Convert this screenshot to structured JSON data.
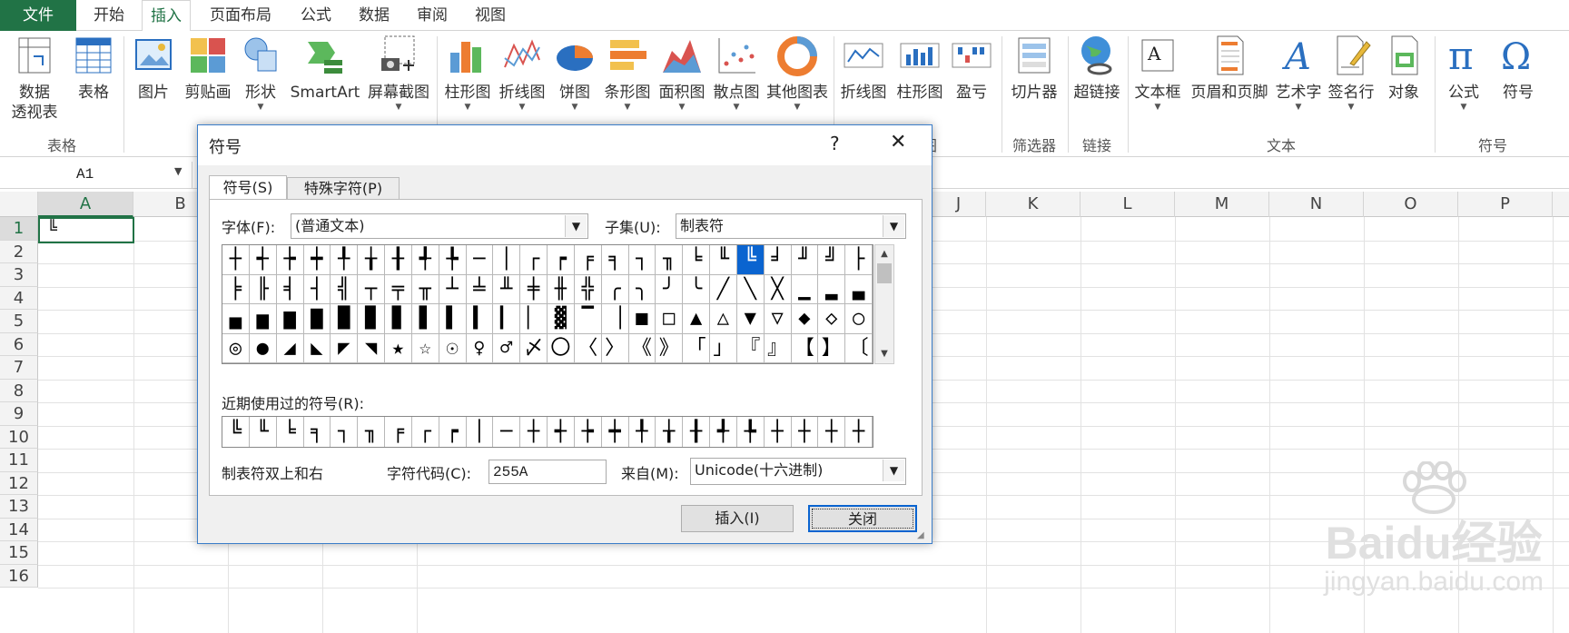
{
  "tabs": {
    "file": "文件",
    "home": "开始",
    "insert": "插入",
    "layout": "页面布局",
    "formulas": "公式",
    "data": "数据",
    "review": "审阅",
    "view": "视图"
  },
  "ribbon": {
    "pivot_l1": "数据",
    "pivot_l2": "透视表",
    "table": "表格",
    "picture": "图片",
    "clipart": "剪贴画",
    "shapes": "形状",
    "smartart": "SmartArt",
    "screenshot": "屏幕截图",
    "bar": "柱形图",
    "line": "折线图",
    "pie": "饼图",
    "hbar": "条形图",
    "area": "面积图",
    "scatter": "散点图",
    "other": "其他图表",
    "sp_line": "折线图",
    "sp_bar": "柱形图",
    "sp_wl": "盈亏",
    "slicer": "切片器",
    "hyperlink": "超链接",
    "textbox": "文本框",
    "headerfooter": "页眉和页脚",
    "wordart": "艺术字",
    "signature": "签名行",
    "object": "对象",
    "equation": "公式",
    "symbol": "符号",
    "groups": {
      "tables": "表格",
      "chart_partial": "图",
      "filter": "筛选器",
      "links": "链接",
      "text": "文本",
      "symbols": "符号"
    }
  },
  "formula_bar": {
    "name_box": "A1"
  },
  "columns": [
    "A",
    "B",
    "J",
    "K",
    "L",
    "M",
    "N",
    "O",
    "P"
  ],
  "rows": [
    "1",
    "2",
    "3",
    "4",
    "5",
    "6",
    "7",
    "8",
    "9",
    "10",
    "11",
    "12",
    "13",
    "14",
    "15",
    "16"
  ],
  "cell_a1": "╚",
  "dialog": {
    "title": "符号",
    "help": "?",
    "close_x": "✕",
    "tab_symbols": "符号(S)",
    "tab_special": "特殊字符(P)",
    "font_label": "字体(F):",
    "font_value": "(普通文本)",
    "subset_label": "子集(U):",
    "subset_value": "制表符",
    "symbols": [
      "┼",
      "┽",
      "┾",
      "┿",
      "╀",
      "╁",
      "╂",
      "╃",
      "╄",
      "─",
      "│",
      "┌",
      "┍",
      "╒",
      "╕",
      "┐",
      "╖",
      "╘",
      "╙",
      "╚",
      "╛",
      "╜",
      "╝",
      "├",
      "╞",
      "╟",
      "╡",
      "┤",
      "╣",
      "┬",
      "╤",
      "╥",
      "┴",
      "╧",
      "╨",
      "╪",
      "╫",
      "╬",
      "╭",
      "╮",
      "╯",
      "╰",
      "╱",
      "╲",
      "╳",
      "▁",
      "▂",
      "▃",
      "▄",
      "▅",
      "▆",
      "▇",
      "█",
      "▉",
      "▊",
      "▋",
      "▌",
      "▍",
      "▎",
      "▏",
      "▓",
      "▔",
      "▕",
      "■",
      "□",
      "▲",
      "△",
      "▼",
      "▽",
      "◆",
      "◇",
      "○",
      "◎",
      "●",
      "◢",
      "◣",
      "◤",
      "◥",
      "★",
      "☆",
      "☉",
      "♀",
      "♂",
      "〆",
      "〇",
      "〈",
      "〉",
      "《",
      "》",
      "「",
      "」",
      "『",
      "』",
      "【",
      "】",
      "〔"
    ],
    "selected_index": 19,
    "scroll_up": "▲",
    "scroll_down": "▼",
    "recent_label": "近期使用过的符号(R):",
    "recent": [
      "╚",
      "╙",
      "╘",
      "╕",
      "┐",
      "╖",
      "╒",
      "┌",
      "┍",
      "│",
      "─",
      "┼",
      "┽",
      "┾",
      "┿",
      "╀",
      "╁",
      "╂",
      "╃",
      "╄",
      "┼",
      "┼",
      "┼",
      "┼"
    ],
    "char_name": "制表符双上和右",
    "code_label": "字符代码(C):",
    "code_value": "255A",
    "from_label": "来自(M):",
    "from_value": "Unicode(十六进制)",
    "insert_btn": "插入(I)",
    "close_btn": "关闭"
  },
  "watermark": {
    "brand": "Baidu经验",
    "url": "jingyan.baidu.com"
  }
}
